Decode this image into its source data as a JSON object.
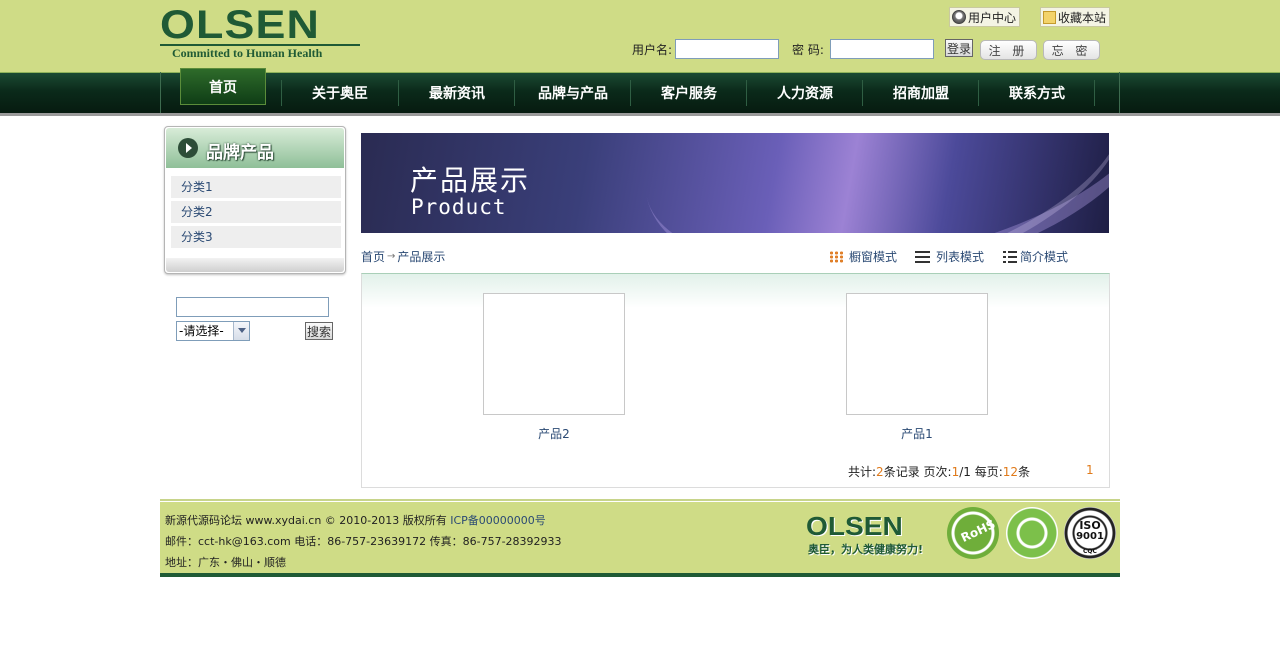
{
  "header": {
    "logo_main": "OLSEN",
    "logo_sub": "Committed to Human Health",
    "user_center": "用户中心",
    "bookmark": "收藏本站",
    "username_label": "用户名:",
    "password_label": "密 码:",
    "login_button": "登录",
    "register_button": "注 册",
    "forgot_button": "忘 密"
  },
  "nav": {
    "items": [
      "首页",
      "关于奥臣",
      "最新资讯",
      "品牌与产品",
      "客户服务",
      "人力资源",
      "招商加盟",
      "联系方式"
    ]
  },
  "sidebar": {
    "title": "品牌产品",
    "categories": [
      "分类1",
      "分类2",
      "分类3"
    ],
    "select_value": "-请选择-",
    "search_button": "搜索"
  },
  "banner": {
    "title_cn": "产品展示",
    "title_en": "Product"
  },
  "breadcrumb": {
    "home": "首页",
    "arrow": "→",
    "current": "产品展示"
  },
  "view_modes": [
    "橱窗模式",
    "列表模式",
    "简介模式"
  ],
  "products": [
    {
      "name": "产品2"
    },
    {
      "name": "产品1"
    }
  ],
  "pager": {
    "total_label": "共计:",
    "total_count": "2",
    "record_unit": "条记录",
    "page_label": "页次:",
    "page_current": "1",
    "page_total": "/1",
    "per_page_label": "每页:",
    "per_page_count": "12",
    "per_page_unit": "条",
    "page_link": "1"
  },
  "footer": {
    "line1": "新源代源码论坛 www.xydai.cn © 2010-2013 版权所有 ",
    "icp": "ICP备00000000号",
    "line2": "邮件：cct-hk@163.com 电话：86-757-23639172  传真：86-757-28392933",
    "line3": "地址：广东・佛山・顺德",
    "logo_main": "OLSEN",
    "logo_sub": "奥臣，为人类健康努力!",
    "badge_rohs": "RoHS",
    "badge_iso_top": "ISO",
    "badge_iso_num": "9001",
    "badge_iso_bottom": "CQC"
  },
  "colors": {
    "header_bg": "#cfdc86",
    "brand_green": "#1f5a35",
    "nav_dark": "#0b2a1a",
    "link_blue": "#2b4a74",
    "accent_orange": "#e07a1a"
  }
}
